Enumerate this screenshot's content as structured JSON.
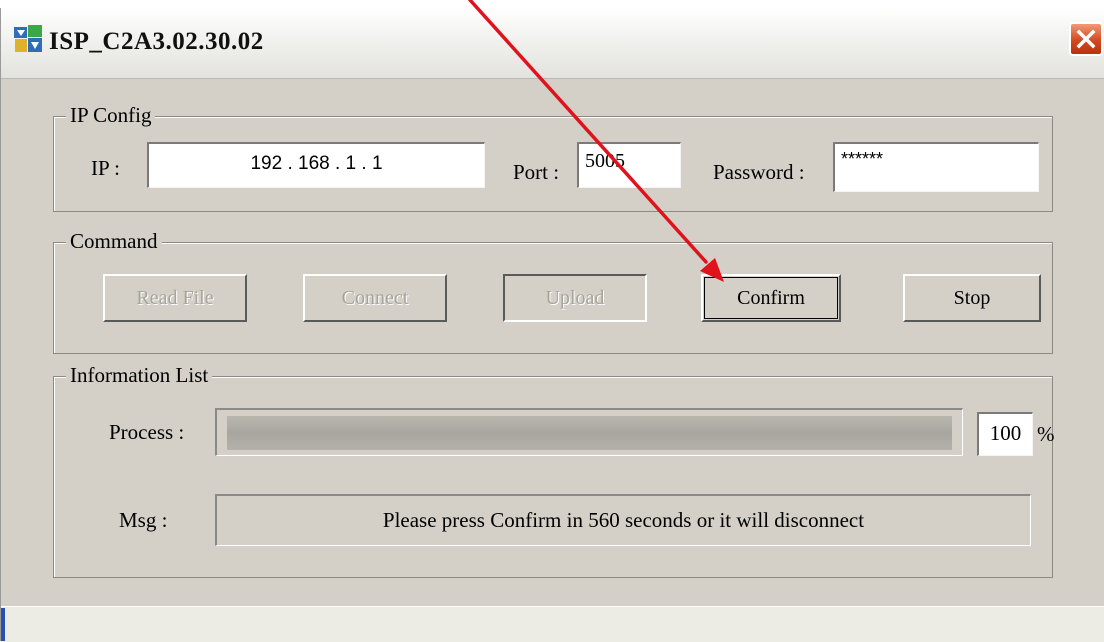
{
  "window": {
    "title": "ISP_C2A3.02.30.02",
    "accent_close": "#d24a20"
  },
  "ip_config": {
    "legend": "IP Config",
    "ip_label": "IP :",
    "ip_value": "192 . 168 . 1 . 1",
    "port_label": "Port :",
    "port_value": "5005",
    "password_label": "Password :",
    "password_value": "******"
  },
  "command": {
    "legend": "Command",
    "read_file_label": "Read File",
    "connect_label": "Connect",
    "upload_label": "Upload",
    "confirm_label": "Confirm",
    "stop_label": "Stop"
  },
  "info": {
    "legend": "Information List",
    "process_label": "Process :",
    "process_percent": "100",
    "percent_sign": "%",
    "progress_fraction": 1.0,
    "msg_label": "Msg :",
    "msg_text": "Please press Confirm in 560 seconds or it will disconnect"
  },
  "annotation": {
    "arrow_color": "#e0121b"
  }
}
